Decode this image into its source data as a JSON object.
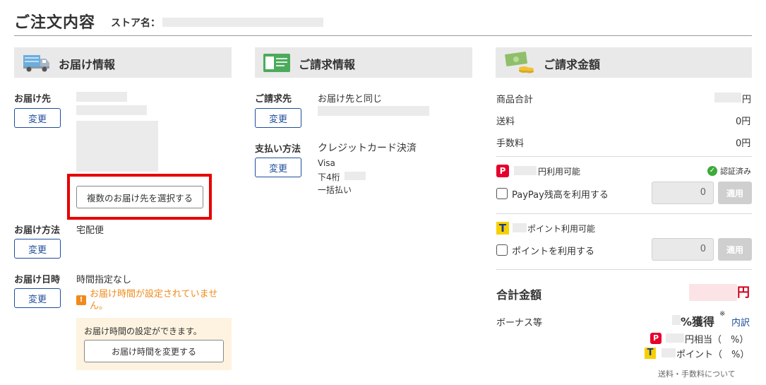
{
  "header": {
    "title": "ご注文内容",
    "store_label": "ストア名："
  },
  "delivery": {
    "section_title": "お届け情報",
    "address_label": "お届け先",
    "change_label": "変更",
    "multi_address_button": "複数のお届け先を選択する",
    "method_label": "お届け方法",
    "method_value": "宅配便",
    "date_label": "お届け日時",
    "date_value": "時間指定なし",
    "time_warning": "お届け時間が設定されていません。",
    "time_note": "お届け時間の設定ができます。",
    "time_change_button": "お届け時間を変更する"
  },
  "billing": {
    "section_title": "ご請求情報",
    "address_label": "ご請求先",
    "address_value": "お届け先と同じ",
    "change_label": "変更",
    "payment_label": "支払い方法",
    "payment_value": "クレジットカード決済",
    "card_brand": "Visa",
    "card_last4_label": "下4桁",
    "installment": "一括払い"
  },
  "amount": {
    "section_title": "ご請求金額",
    "subtotal_label": "商品合計",
    "subtotal_unit": "円",
    "shipping_label": "送料",
    "shipping_value": "0円",
    "fee_label": "手数料",
    "fee_value": "0円",
    "paypay_available": "円利用可能",
    "verified_label": "認証済み",
    "paypay_use_label": "PayPay残高を利用する",
    "paypay_input_value": "0",
    "apply_label": "適用",
    "tpoint_available": "ポイント利用可能",
    "tpoint_use_label": "ポイントを利用する",
    "tpoint_input_value": "0",
    "total_label": "合計金額",
    "total_unit": "円",
    "bonus_label": "ボーナス等",
    "bonus_value": "%獲得",
    "bonus_mark": "※",
    "breakdown_link": "内訳",
    "paypay_equiv": "円相当（　%）",
    "tpoint_equiv": "ポイント（　%）",
    "footer_link": "送料・手数料について"
  },
  "colors": {
    "accent_blue": "#1e4e9a",
    "warning_orange": "#f08a1c",
    "total_red": "#d0021b",
    "highlight_red": "#e60000"
  }
}
